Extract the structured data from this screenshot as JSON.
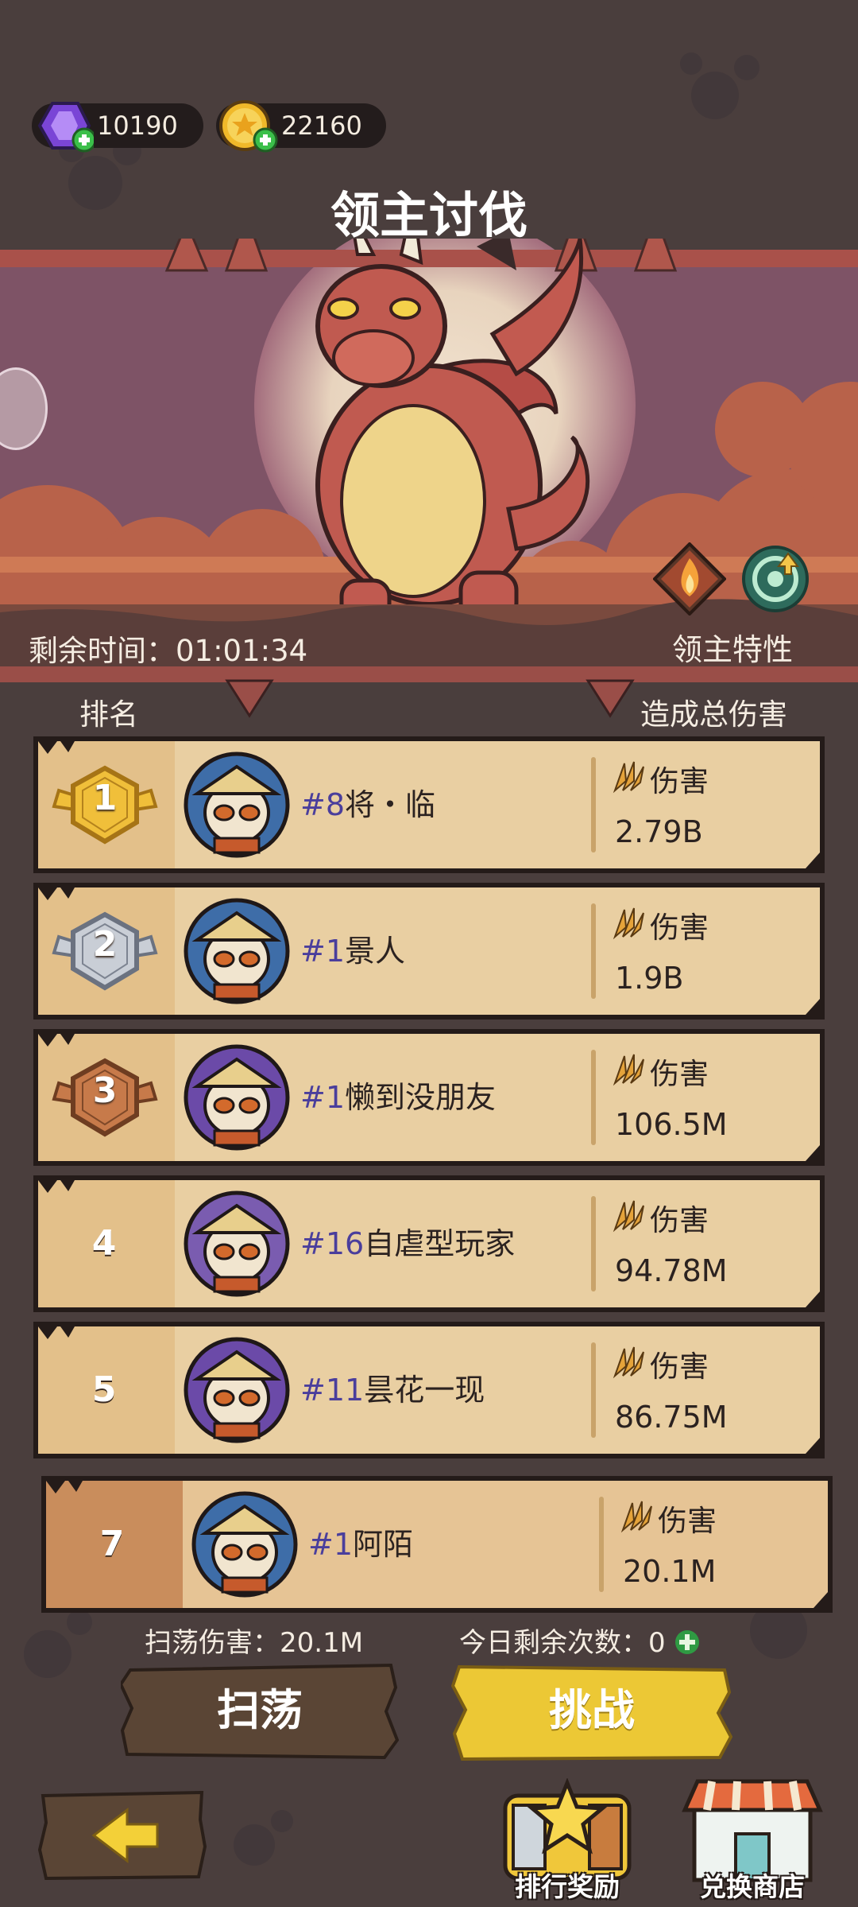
{
  "currency": {
    "gems": {
      "icon": "purple-gem-icon",
      "value": "10190"
    },
    "coins": {
      "icon": "gold-star-coin-icon",
      "value": "22160"
    }
  },
  "title": "领主讨伐",
  "boss": {
    "icon": "red-dragon-boss"
  },
  "timer": {
    "label": "剩余时间：",
    "value": "01:01:34"
  },
  "lord_traits": "领主特性",
  "columns": {
    "rank": "排名",
    "damage": "造成总伤害"
  },
  "damage_label": "伤害",
  "rows": [
    {
      "rank": "1",
      "level": "#8",
      "name": "将・临",
      "damage": "2.79B"
    },
    {
      "rank": "2",
      "level": "#1",
      "name": "景人",
      "damage": "1.9B"
    },
    {
      "rank": "3",
      "level": "#1",
      "name": "懒到没朋友",
      "damage": "106.5M"
    },
    {
      "rank": "4",
      "level": "#16",
      "name": "自虐型玩家",
      "damage": "94.78M"
    },
    {
      "rank": "5",
      "level": "#11",
      "name": "昙花一现",
      "damage": "86.75M"
    }
  ],
  "self_row": {
    "rank": "7",
    "level": "#1",
    "name": "阿陌",
    "damage": "20.1M"
  },
  "stats": {
    "sweep_damage": "扫荡伤害：20.1M",
    "remaining_today": "今日剩余次数：0"
  },
  "buttons": {
    "sweep": "扫荡",
    "challenge": "挑战"
  },
  "bottom": {
    "rank_rewards": "排行奖励",
    "exchange_shop": "兑换商店"
  },
  "colors": {
    "background": "#4a3e3d",
    "plank": "#e9cda0",
    "challenge": "#e8c433",
    "sweep": "#5a4535"
  }
}
